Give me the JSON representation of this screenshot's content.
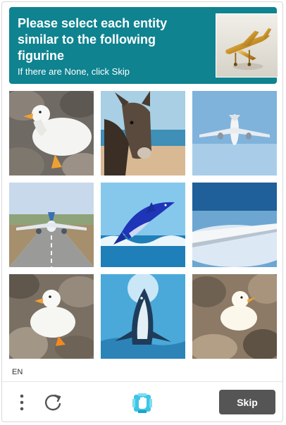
{
  "challenge": {
    "prompt_line1": "Please select each entity",
    "prompt_line2": "similar to the following",
    "prompt_line3": "figurine",
    "instruction": "If there are None, click Skip",
    "example_icon": "airplane-figurine-icon"
  },
  "tiles": [
    {
      "subject": "duck-icon"
    },
    {
      "subject": "donkey-icon"
    },
    {
      "subject": "airplane-icon"
    },
    {
      "subject": "airplane-icon"
    },
    {
      "subject": "dolphin-icon"
    },
    {
      "subject": "airplane-wing-icon"
    },
    {
      "subject": "duck-icon"
    },
    {
      "subject": "dolphin-icon"
    },
    {
      "subject": "duck-icon"
    }
  ],
  "footer": {
    "language": "EN",
    "skip_label": "Skip",
    "menu_icon": "vertical-dots-icon",
    "refresh_icon": "refresh-icon",
    "logo_icon": "hand-logo-icon"
  },
  "colors": {
    "prompt_bg": "#0f8390",
    "skip_bg": "#555555",
    "logo_blue": "#3ec5e6"
  }
}
